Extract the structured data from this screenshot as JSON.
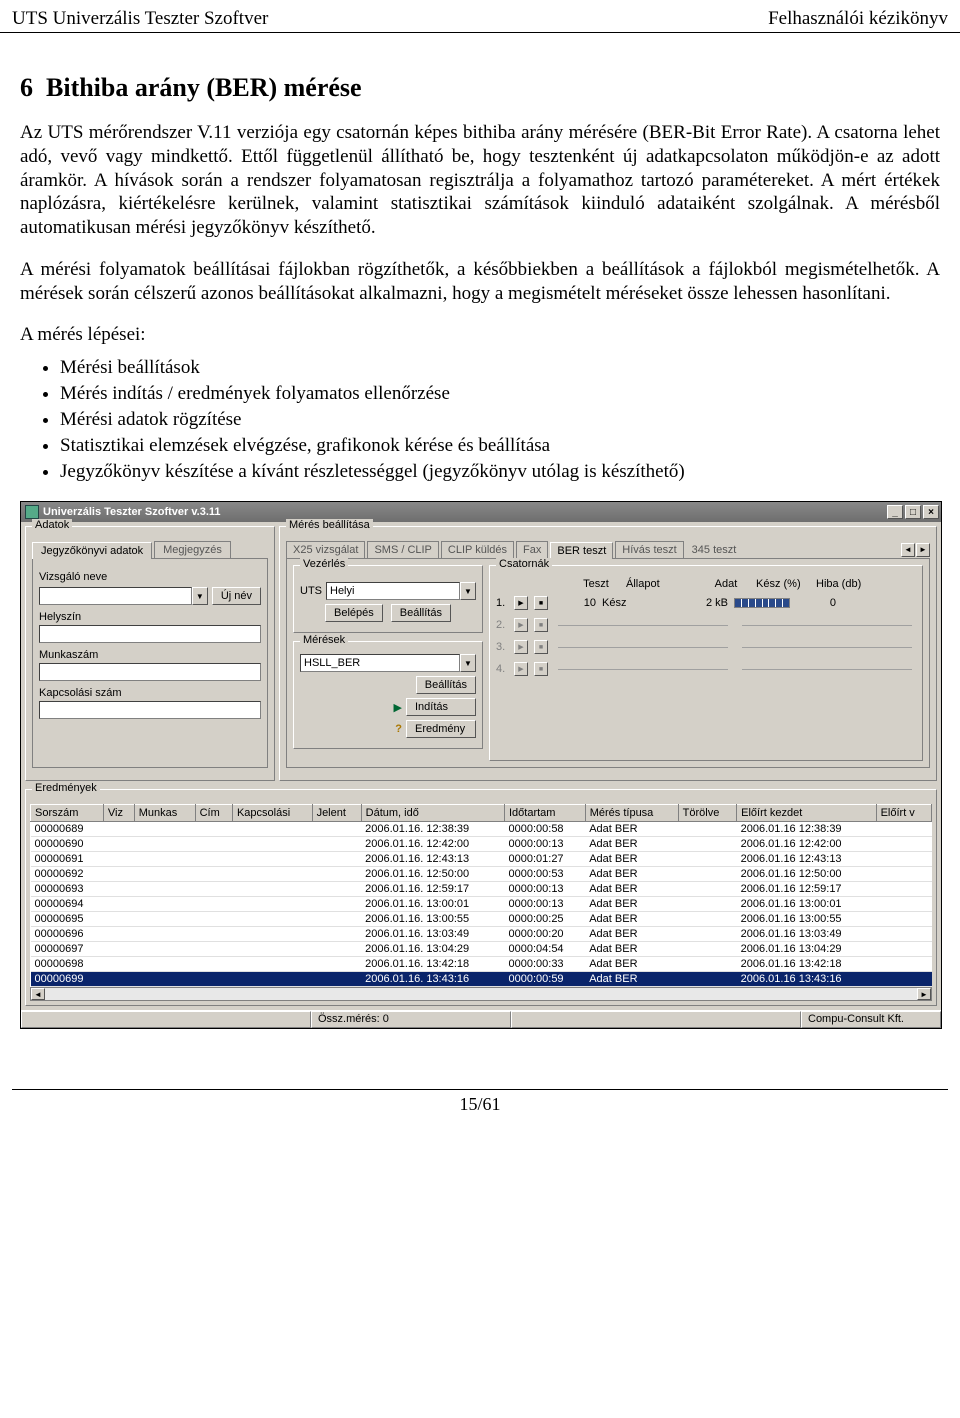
{
  "header": {
    "left": "UTS Univerzális Teszter Szoftver",
    "right": "Felhasználói kézikönyv"
  },
  "section": {
    "num": "6",
    "title": "Bithiba arány (BER) mérése",
    "p1": "Az UTS mérőrendszer V.11 verziója egy csatornán képes bithiba arány mérésére (BER-Bit Error Rate). A csatorna lehet adó, vevő vagy mindkettő. Ettől függetlenül állítható be, hogy tesztenként új adatkapcsolaton működjön-e az adott áramkör. A hívások során a rendszer folyamatosan regisztrálja a folyamathoz tartozó paramétereket. A mért értékek naplózásra, kiértékelésre kerülnek, valamint statisztikai számítások kiinduló adataiként szolgálnak. A mérésből automatikusan mérési jegyzőkönyv készíthető.",
    "p2": "A mérési folyamatok beállításai fájlokban rögzíthetők, a későbbiekben a beállítások a fájlokból megismételhetők. A mérések során célszerű azonos beállításokat alkalmazni, hogy a megismételt méréseket össze lehessen hasonlítani.",
    "p3": "A mérés lépései:",
    "bullets": [
      "Mérési beállítások",
      "Mérés indítás / eredmények folyamatos ellenőrzése",
      "Mérési adatok rögzítése",
      "Statisztikai elemzések elvégzése, grafikonok kérése és beállítása",
      "Jegyzőkönyv készítése a kívánt részletességgel (jegyzőkönyv utólag is készíthető)"
    ]
  },
  "app": {
    "title": "Univerzális Teszter Szoftver v.3.11",
    "adatok": {
      "legend": "Adatok",
      "tabs": [
        "Jegyzőkönyvi adatok",
        "Megjegyzés"
      ],
      "labels": {
        "vizsgalo": "Vizsgáló neve",
        "ujnev": "Új név",
        "helyszin": "Helyszín",
        "munkaszam": "Munkaszám",
        "kapcsolasi": "Kapcsolási szám"
      }
    },
    "meres": {
      "legend": "Mérés beállítása",
      "tabs": [
        "X25 vizsgálat",
        "SMS / CLIP",
        "CLIP küldés",
        "Fax",
        "BER teszt",
        "Hívás teszt",
        "345 teszt"
      ],
      "vezerles": {
        "legend": "Vezérlés",
        "uts": "UTS",
        "helyi": "Helyi",
        "belepes": "Belépés",
        "beallitas": "Beállítás"
      },
      "meresek": {
        "legend": "Mérések",
        "value": "HSLL_BER",
        "beallitas": "Beállítás",
        "inditas": "Indítás",
        "eredmeny": "Eredmény"
      },
      "csatornak": {
        "legend": "Csatornák",
        "cols": [
          "Teszt",
          "Állapot",
          "Adat",
          "Kész (%)",
          "Hiba (db)"
        ],
        "rows": [
          {
            "n": "1.",
            "teszt": "10",
            "allapot": "Kész",
            "adat": "2 kB",
            "hiba": "0",
            "active": true
          },
          {
            "n": "2.",
            "active": false
          },
          {
            "n": "3.",
            "active": false
          },
          {
            "n": "4.",
            "active": false
          }
        ]
      }
    },
    "results": {
      "legend": "Eredmények",
      "cols": [
        "Sorszám",
        "Viz",
        "Munkas",
        "Cím",
        "Kapcsolási",
        "Jelent",
        "Dátum, idő",
        "Időtartam",
        "Mérés típusa",
        "Törölve",
        "Előírt kezdet",
        "Előírt v"
      ],
      "rows": [
        {
          "s": "00000689",
          "d": "2006.01.16. 12:38:39",
          "t": "0000:00:58",
          "m": "Adat BER",
          "k": "2006.01.16 12:38:39"
        },
        {
          "s": "00000690",
          "d": "2006.01.16. 12:42:00",
          "t": "0000:00:13",
          "m": "Adat BER",
          "k": "2006.01.16 12:42:00"
        },
        {
          "s": "00000691",
          "d": "2006.01.16. 12:43:13",
          "t": "0000:01:27",
          "m": "Adat BER",
          "k": "2006.01.16 12:43:13"
        },
        {
          "s": "00000692",
          "d": "2006.01.16. 12:50:00",
          "t": "0000:00:53",
          "m": "Adat BER",
          "k": "2006.01.16 12:50:00"
        },
        {
          "s": "00000693",
          "d": "2006.01.16. 12:59:17",
          "t": "0000:00:13",
          "m": "Adat BER",
          "k": "2006.01.16 12:59:17"
        },
        {
          "s": "00000694",
          "d": "2006.01.16. 13:00:01",
          "t": "0000:00:13",
          "m": "Adat BER",
          "k": "2006.01.16 13:00:01"
        },
        {
          "s": "00000695",
          "d": "2006.01.16. 13:00:55",
          "t": "0000:00:25",
          "m": "Adat BER",
          "k": "2006.01.16 13:00:55"
        },
        {
          "s": "00000696",
          "d": "2006.01.16. 13:03:49",
          "t": "0000:00:20",
          "m": "Adat BER",
          "k": "2006.01.16 13:03:49"
        },
        {
          "s": "00000697",
          "d": "2006.01.16. 13:04:29",
          "t": "0000:04:54",
          "m": "Adat BER",
          "k": "2006.01.16 13:04:29"
        },
        {
          "s": "00000698",
          "d": "2006.01.16. 13:42:18",
          "t": "0000:00:33",
          "m": "Adat BER",
          "k": "2006.01.16 13:42:18"
        },
        {
          "s": "00000699",
          "d": "2006.01.16. 13:43:16",
          "t": "0000:00:59",
          "m": "Adat BER",
          "k": "2006.01.16 13:43:16",
          "sel": true
        }
      ]
    },
    "status": {
      "ossz": "Össz.mérés: 0",
      "vendor": "Compu-Consult Kft."
    }
  },
  "footer": "15/61"
}
